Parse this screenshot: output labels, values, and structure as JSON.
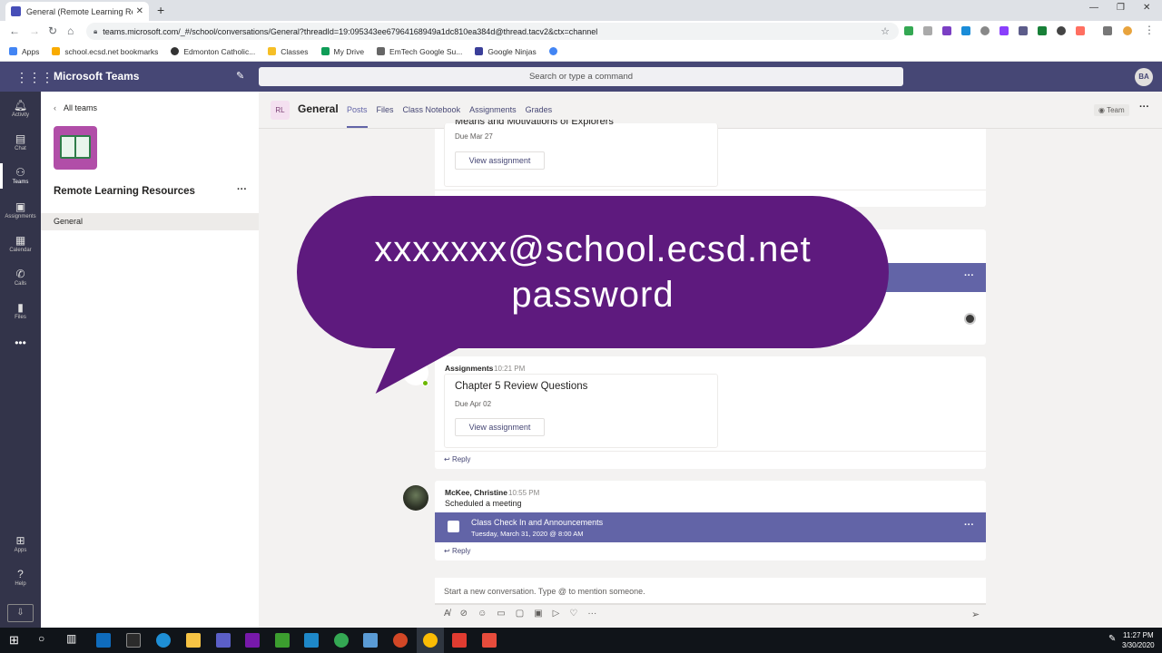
{
  "browser": {
    "tab_title": "General (Remote Learning Resou",
    "url": "teams.microsoft.com/_#/school/conversations/General?threadId=19:095343ee67964168949a1dc810ea384d@thread.tacv2&ctx=channel",
    "bookmarks": [
      "Apps",
      "school.ecsd.net bookmarks",
      "Edmonton Catholic...",
      "Classes",
      "My Drive",
      "EmTech Google Su...",
      "Google Ninjas"
    ]
  },
  "teams": {
    "app_name": "Microsoft Teams",
    "search_placeholder": "Search or type a command",
    "user_initials": "BA",
    "rail": [
      {
        "label": "Activity"
      },
      {
        "label": "Chat"
      },
      {
        "label": "Teams"
      },
      {
        "label": "Assignments"
      },
      {
        "label": "Calendar"
      },
      {
        "label": "Calls"
      },
      {
        "label": "Files"
      },
      {
        "label": "Apps"
      },
      {
        "label": "Help"
      }
    ]
  },
  "sidebar": {
    "back_label": "All teams",
    "team_name": "Remote Learning Resources",
    "channel": "General"
  },
  "channel": {
    "avatar": "RL",
    "title": "General",
    "tabs": [
      "Posts",
      "Files",
      "Class Notebook",
      "Assignments",
      "Grades"
    ],
    "team_button": "Team"
  },
  "posts": {
    "top_card": {
      "partial_title": "Means and Motivations of Explorers",
      "due": "Due Mar 27",
      "button": "View assignment"
    },
    "assignment_post": {
      "author": "Assignments",
      "time": "10:21 PM",
      "title": "Chapter 5 Review Questions",
      "due": "Due Apr 02",
      "button": "View assignment",
      "reply": "Reply"
    },
    "meeting_post": {
      "author": "McKee, Christine",
      "time": "10:55 PM",
      "text": "Scheduled a meeting",
      "meeting_title": "Class Check In and Announcements",
      "meeting_date": "Tuesday, March 31, 2020 @ 8:00 AM",
      "reply": "Reply"
    }
  },
  "compose": {
    "placeholder": "Start a new conversation. Type @ to mention someone."
  },
  "overlay": {
    "line1": "xxxxxxx@school.ecsd.net",
    "line2": "password"
  },
  "taskbar": {
    "time": "11:27 PM",
    "date": "3/30/2020"
  },
  "colors": {
    "teams_header": "#464775",
    "rail": "#33344a",
    "accent": "#6264a7",
    "bubble": "#5e1a7e"
  }
}
